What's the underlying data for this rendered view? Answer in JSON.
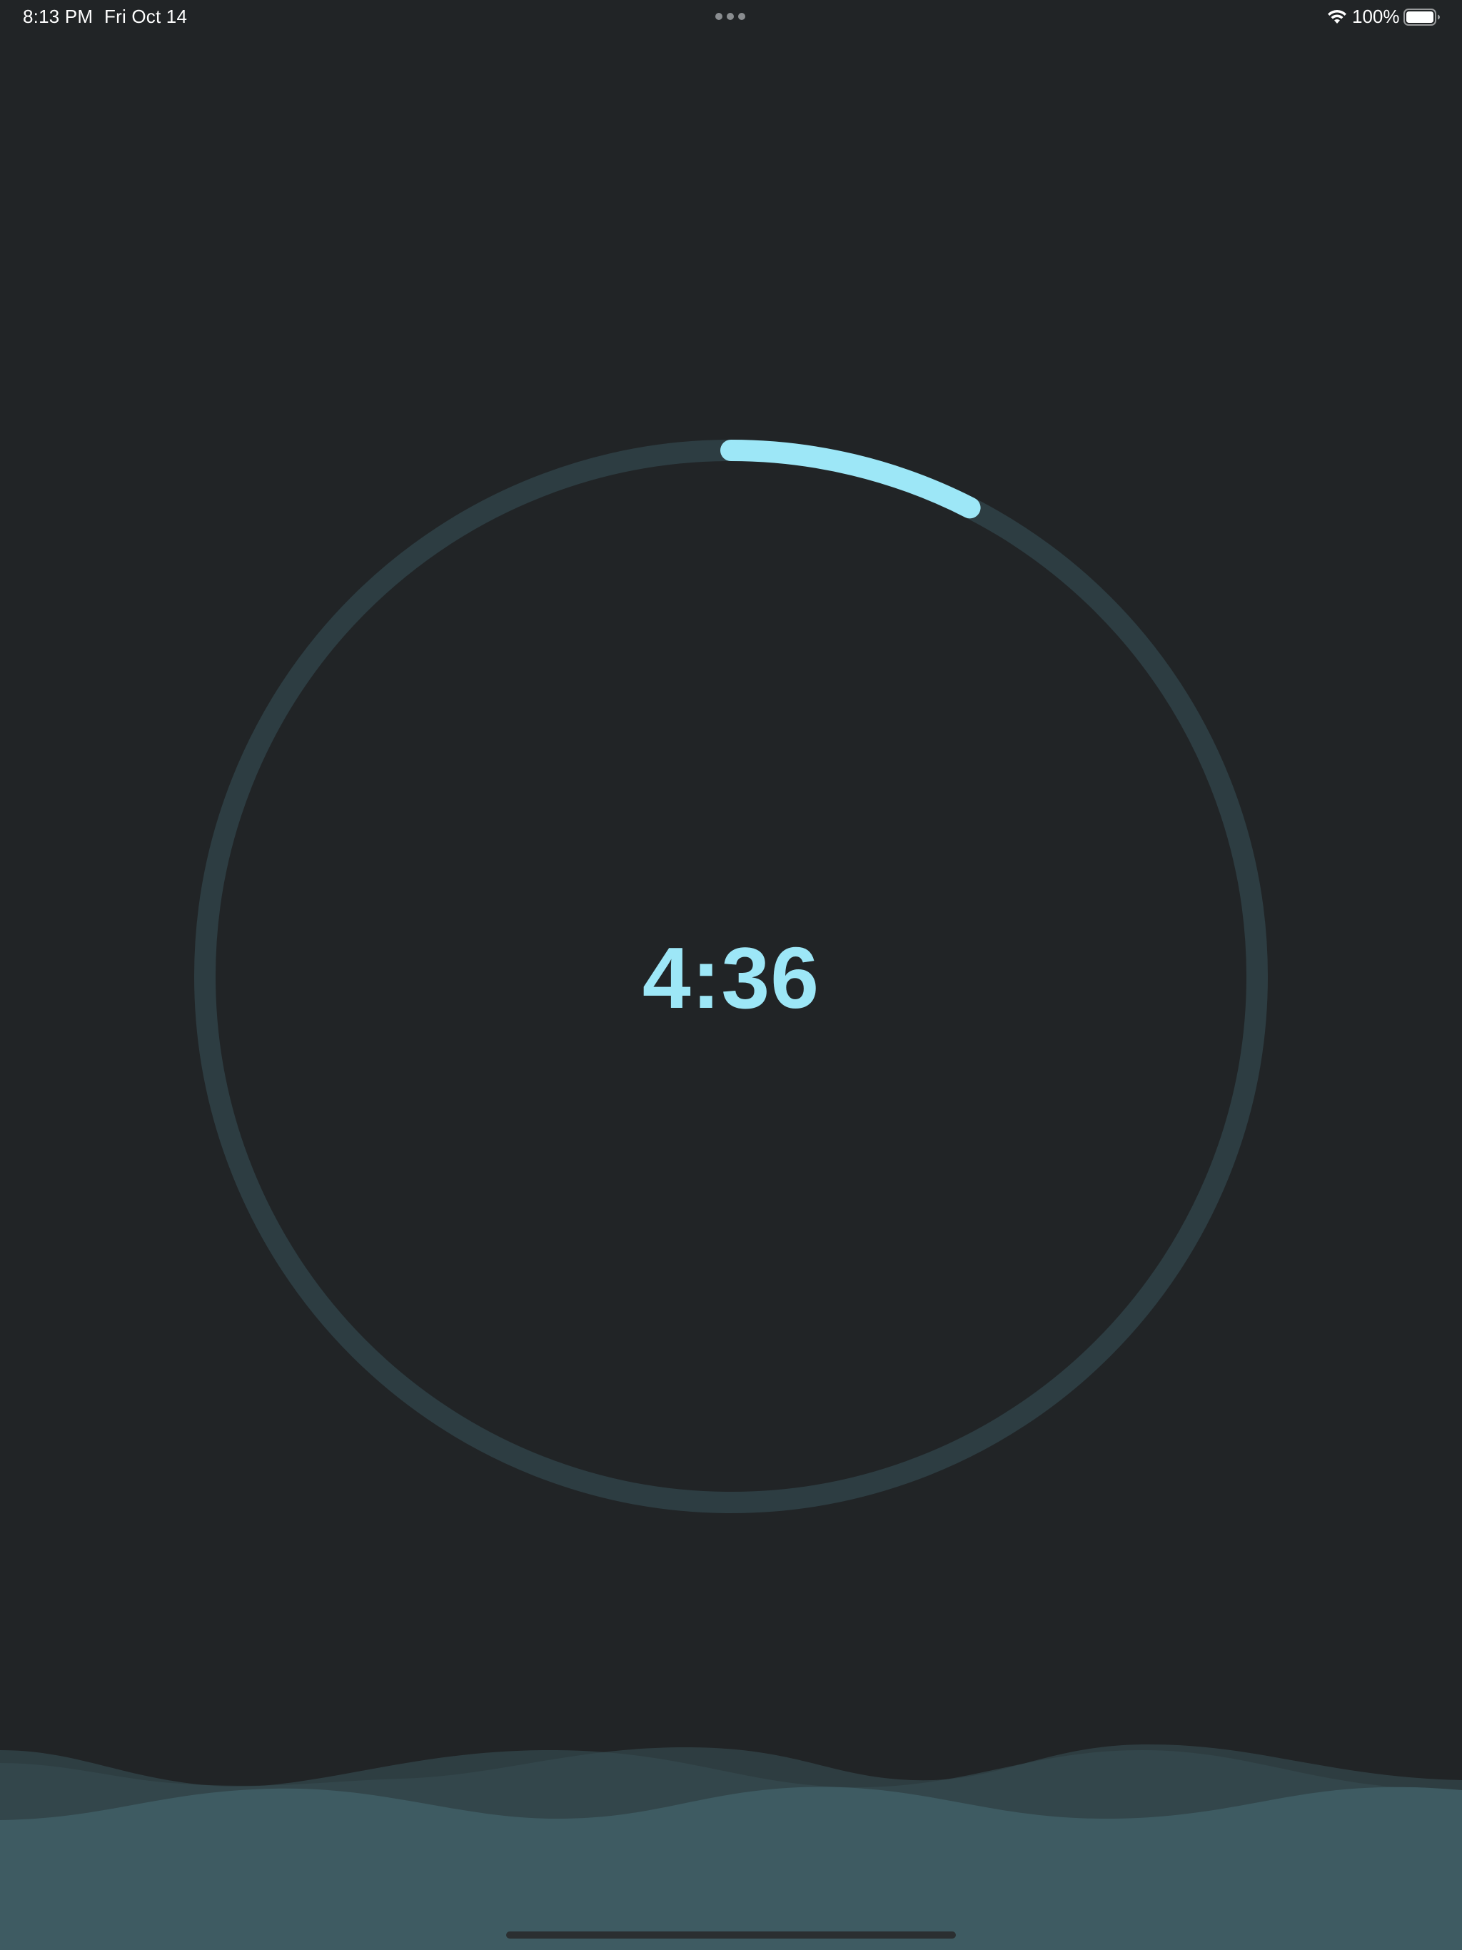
{
  "status_bar": {
    "time": "8:13 PM",
    "date": "Fri Oct 14",
    "battery_percent": "100%",
    "icons": [
      "multitask-dots-icon",
      "wifi-icon",
      "battery-icon"
    ]
  },
  "timer": {
    "remaining": "4:36",
    "progress_fraction": 0.075
  },
  "colors": {
    "background": "#212426",
    "ring_track": "#2d3d42",
    "ring_progress": "#9de7f7",
    "timer_text": "#9de7f7",
    "wave_fill": "#3e5b62",
    "wave_back": "#33474c"
  }
}
